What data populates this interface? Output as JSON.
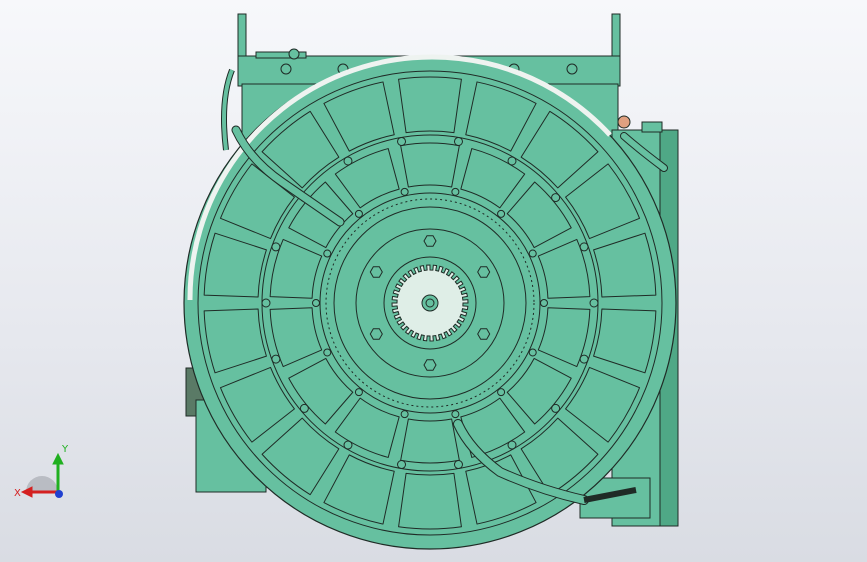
{
  "viewport": {
    "background_top": "#f7f8fb",
    "background_bottom": "#d9dce3"
  },
  "model": {
    "body_color": "#66c0a0",
    "body_shade_color": "#4fa886",
    "edge_color": "#1f2b26",
    "highlight_color": "#eef3f0",
    "accent_color": "#e0a080",
    "pad_ring_outer_count": 18,
    "pad_ring_inner_count": 14,
    "spline_tooth_count": 36
  },
  "triad": {
    "x_label": "X",
    "y_label": "Y",
    "x_color": "#d42020",
    "y_color": "#20b020",
    "z_color": "#2040d0"
  }
}
